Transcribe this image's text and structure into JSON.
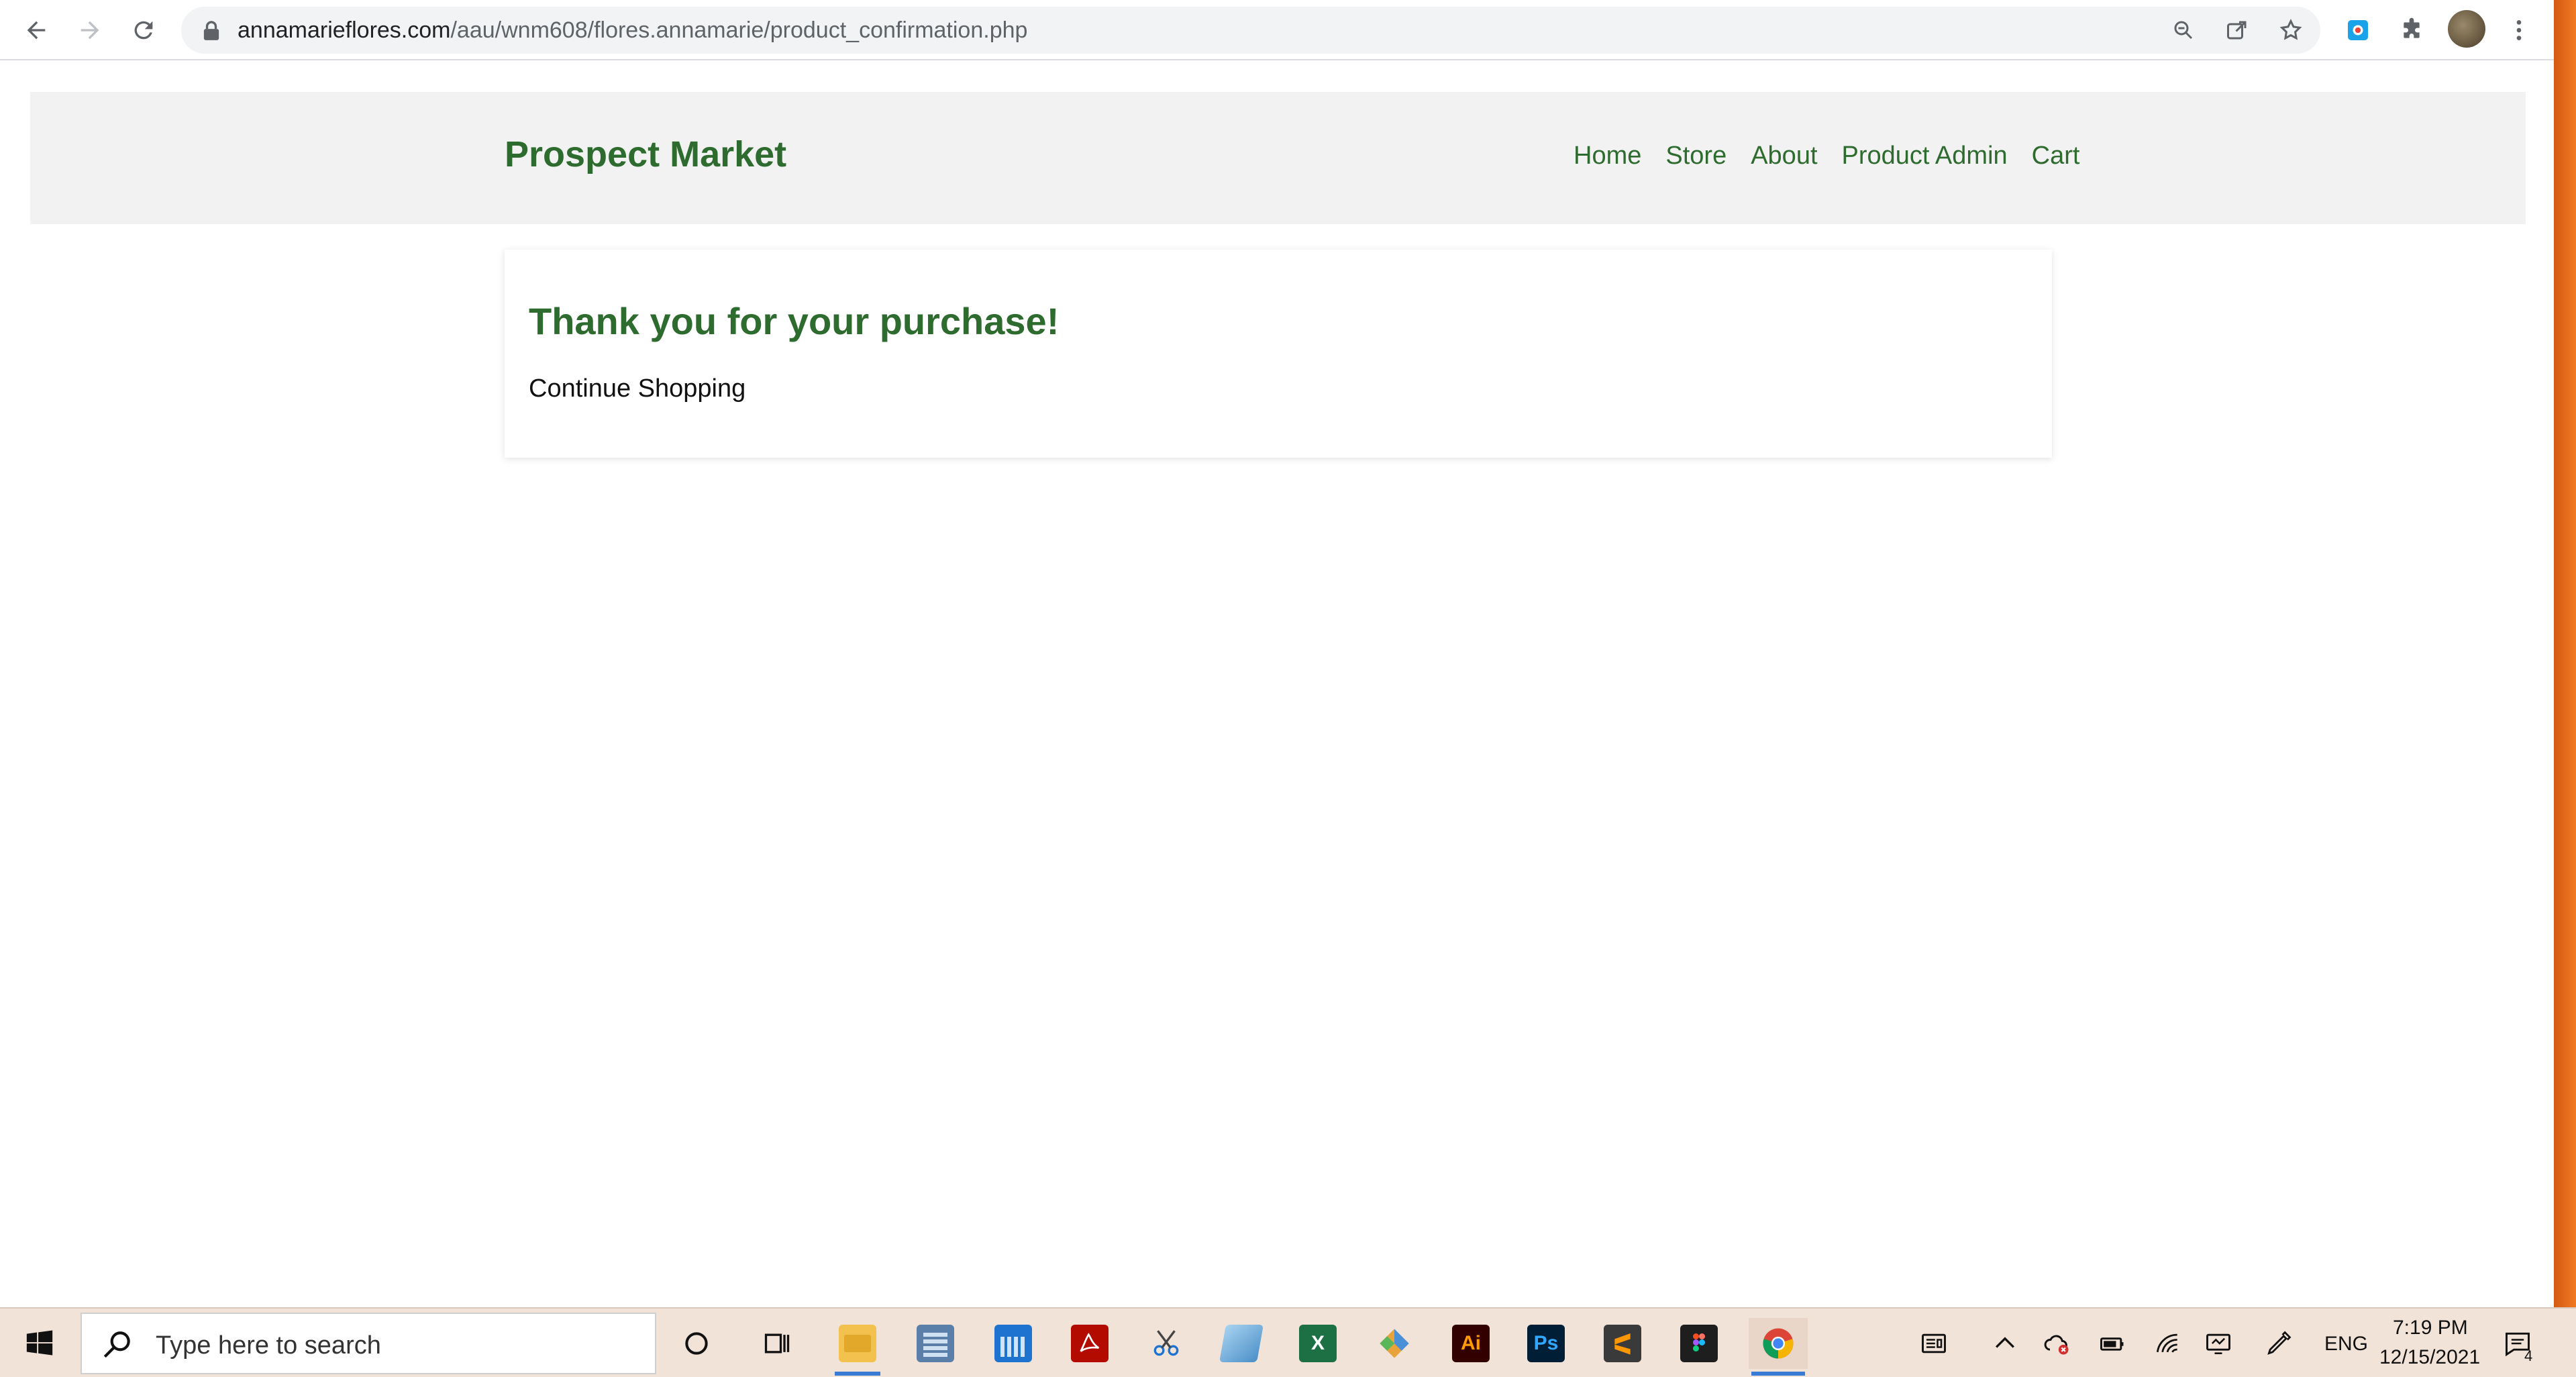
{
  "browser": {
    "url_domain": "annamarieflores.com",
    "url_path": "/aau/wnm608/flores.annamarie/product_confirmation.php",
    "icons": [
      "back-arrow-icon",
      "forward-arrow-icon",
      "reload-icon",
      "lock-icon",
      "zoom-icon",
      "share-icon",
      "bookmark-star-icon",
      "extension-icon",
      "puzzle-icon",
      "avatar",
      "kebab-menu-icon"
    ]
  },
  "site": {
    "brand": "Prospect Market",
    "nav": [
      "Home",
      "Store",
      "About",
      "Product Admin",
      "Cart"
    ],
    "accent_color": "#2e6b2e"
  },
  "confirmation": {
    "title": "Thank you for your purchase!",
    "link": "Continue Shopping"
  },
  "taskbar": {
    "search_placeholder": "Type here to search",
    "apps": [
      "cortana-icon",
      "task-view-icon",
      "file-explorer-icon",
      "calculator-icon",
      "calendar-icon",
      "acrobat-icon",
      "snipping-icon",
      "notepad-icon",
      "excel-icon",
      "git-icon",
      "illustrator-icon",
      "photoshop-icon",
      "sublime-icon",
      "figma-icon",
      "chrome-icon"
    ],
    "app_labels": {
      "excel": "X",
      "illustrator": "Ai",
      "photoshop": "Ps"
    },
    "language": "ENG",
    "time": "7:19 PM",
    "date": "12/15/2021",
    "notification_count": "4"
  }
}
